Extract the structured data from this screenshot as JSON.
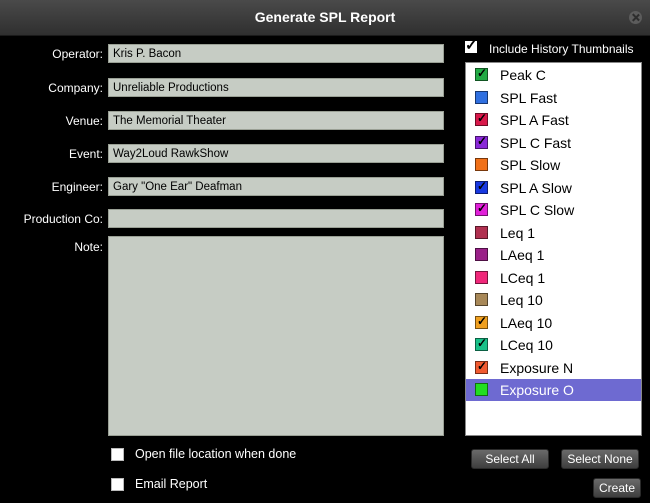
{
  "window": {
    "title": "Generate SPL Report"
  },
  "form": {
    "operator_label": "Operator:",
    "operator_value": "Kris P. Bacon",
    "company_label": "Company:",
    "company_value": "Unreliable Productions",
    "venue_label": "Venue:",
    "venue_value": "The Memorial Theater",
    "event_label": "Event:",
    "event_value": "Way2Loud RawkShow",
    "engineer_label": "Engineer:",
    "engineer_value": "Gary \"One Ear\" Deafman",
    "production_label": "Production Co:",
    "production_value": "",
    "note_label": "Note:"
  },
  "options": {
    "open_file_label": "Open file location when done",
    "open_file_checked": false,
    "email_label": "Email Report",
    "email_checked": false
  },
  "history": {
    "label": "Include History Thumbnails",
    "checked": true
  },
  "metrics": [
    {
      "label": "Peak C",
      "color": "#22aa44",
      "checked": true
    },
    {
      "label": "SPL Fast",
      "color": "#2f6fe0",
      "checked": false
    },
    {
      "label": "SPL A Fast",
      "color": "#d8184a",
      "checked": true
    },
    {
      "label": "SPL C Fast",
      "color": "#8a28d8",
      "checked": true
    },
    {
      "label": "SPL Slow",
      "color": "#f07018",
      "checked": false
    },
    {
      "label": "SPL A Slow",
      "color": "#1838e0",
      "checked": true
    },
    {
      "label": "SPL C Slow",
      "color": "#e020d8",
      "checked": true
    },
    {
      "label": "Leq 1",
      "color": "#b03050",
      "checked": false
    },
    {
      "label": "LAeq 1",
      "color": "#9a2088",
      "checked": false
    },
    {
      "label": "LCeq 1",
      "color": "#f0287a",
      "checked": false
    },
    {
      "label": "Leq 10",
      "color": "#a88858",
      "checked": false
    },
    {
      "label": "LAeq 10",
      "color": "#f0a020",
      "checked": true
    },
    {
      "label": "LCeq 10",
      "color": "#18c088",
      "checked": true
    },
    {
      "label": "Exposure N",
      "color": "#f05a30",
      "checked": true
    },
    {
      "label": "Exposure O",
      "color": "#22dd22",
      "checked": false,
      "selected": true
    }
  ],
  "buttons": {
    "select_all": "Select All",
    "select_none": "Select None",
    "create": "Create"
  }
}
